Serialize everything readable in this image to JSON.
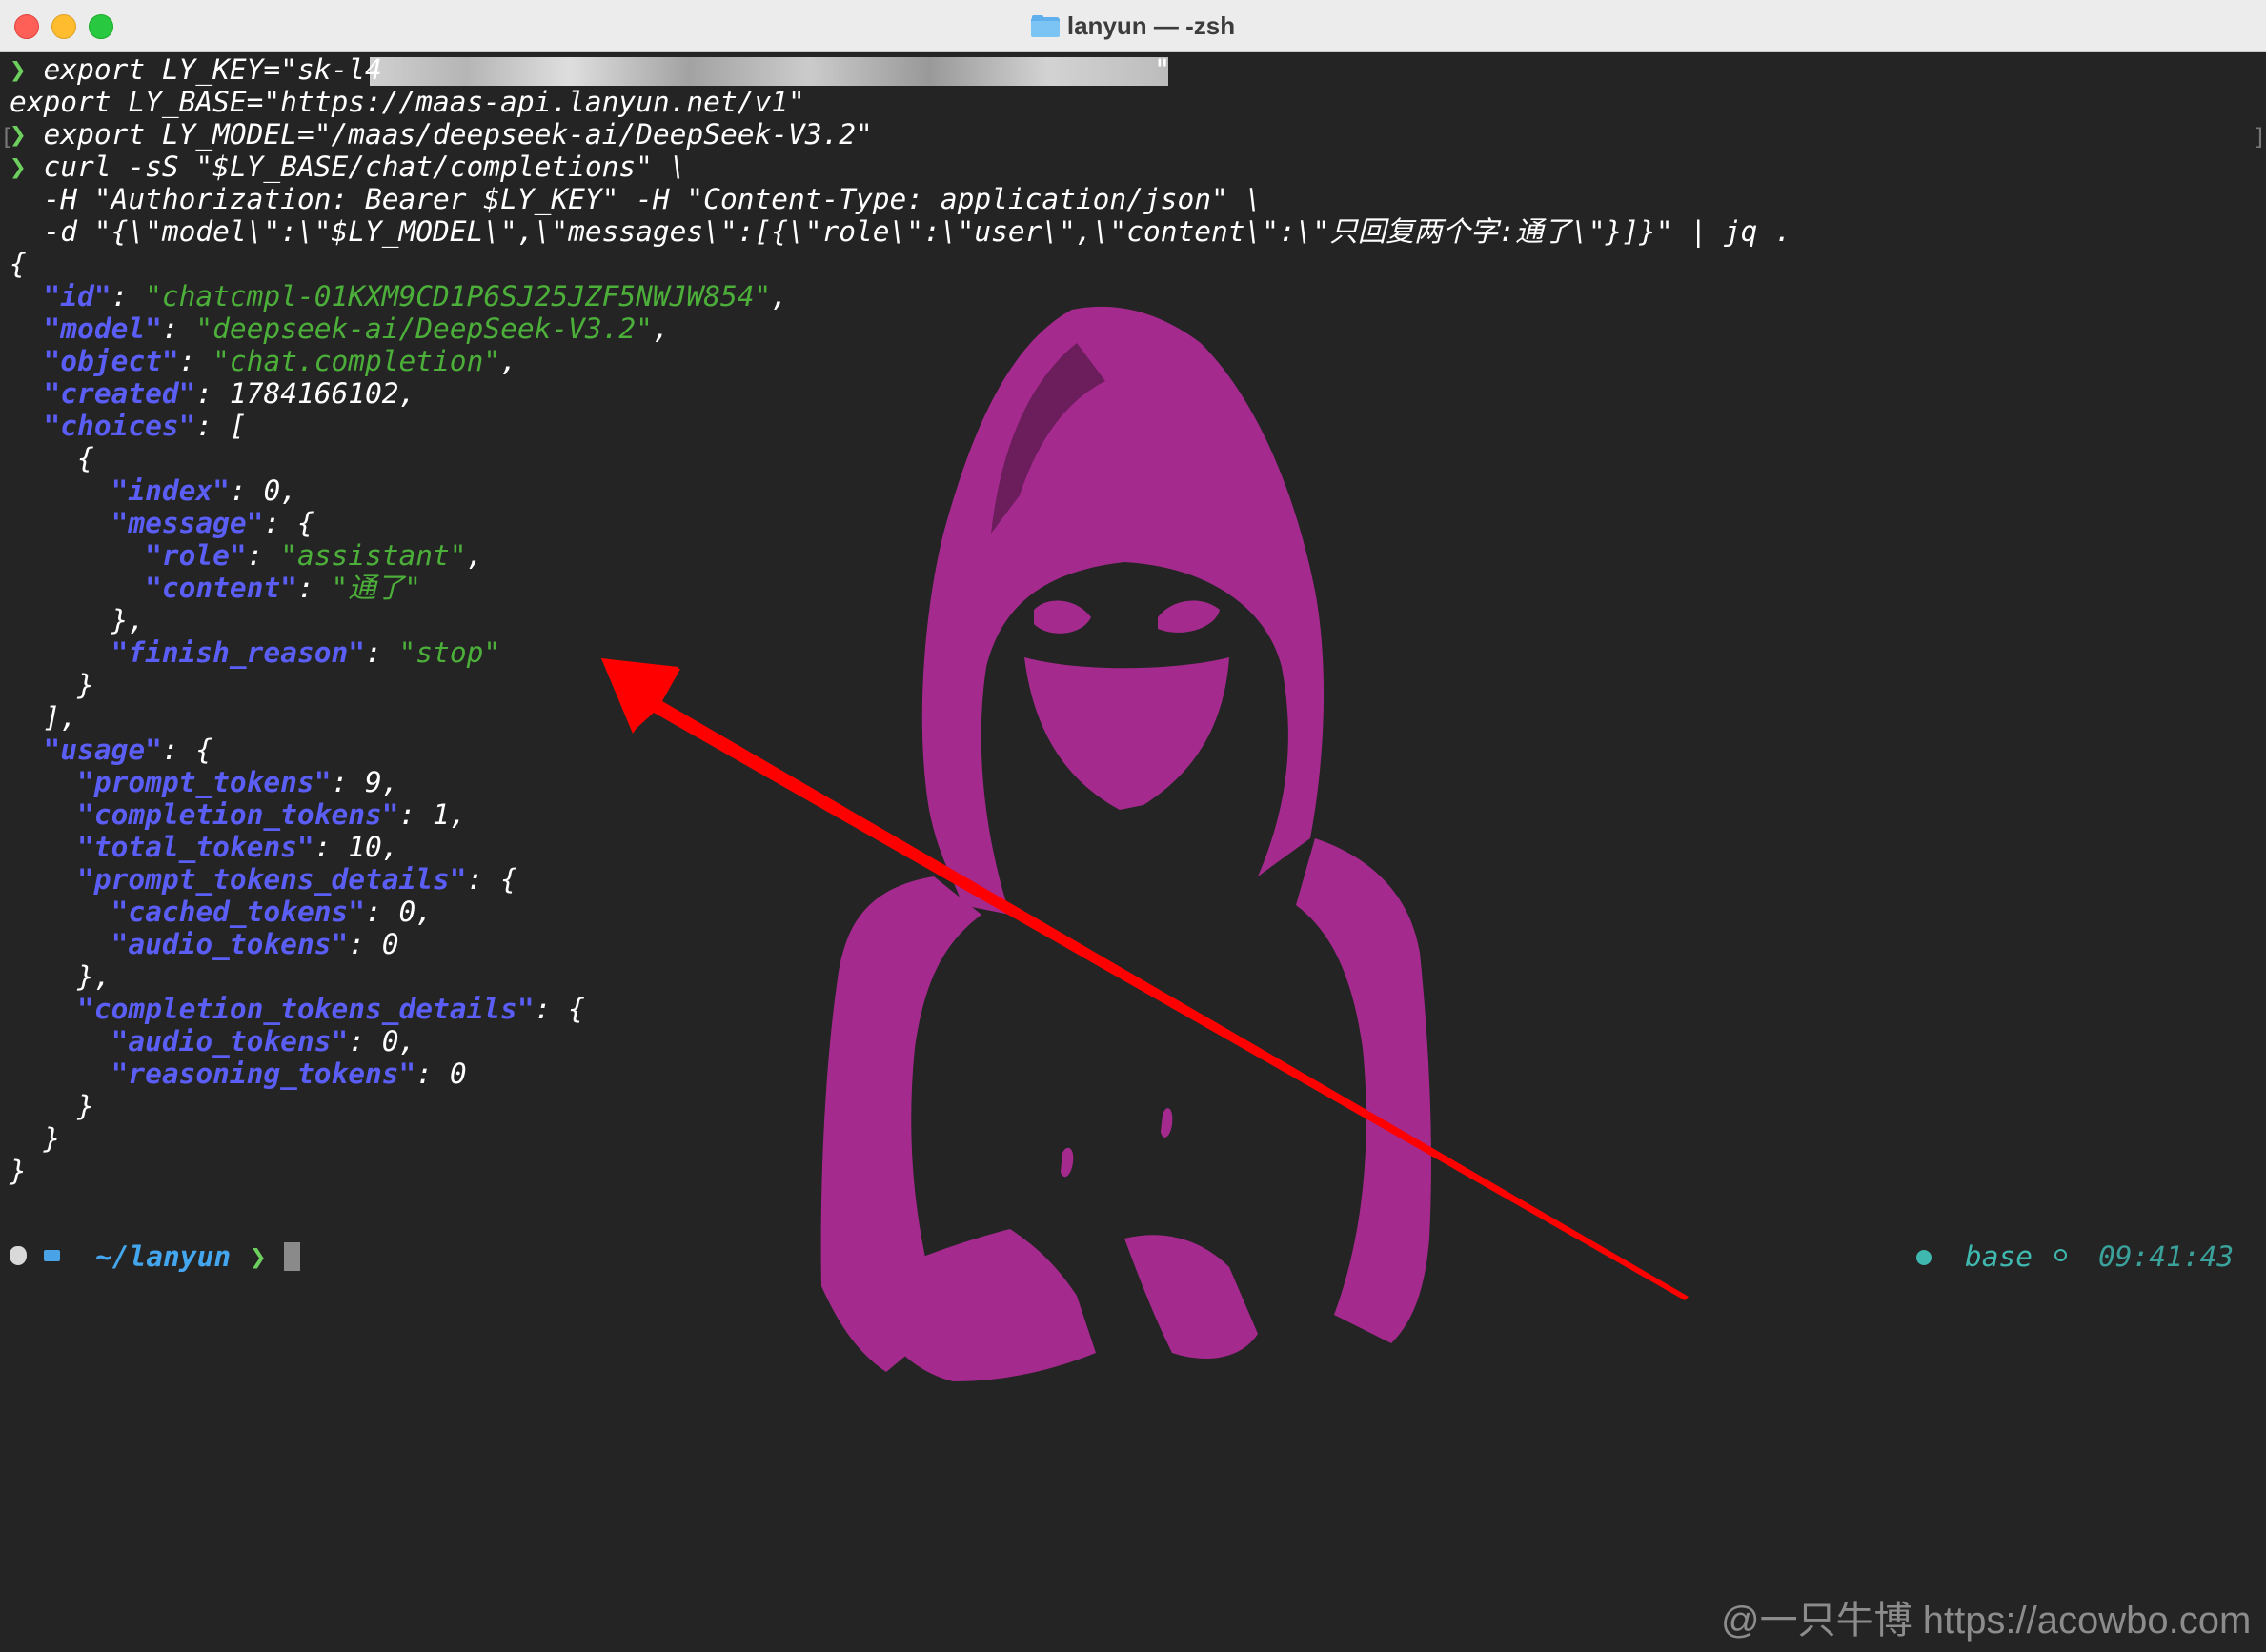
{
  "window": {
    "title": "lanyun — -zsh",
    "folder_icon": "folder-icon"
  },
  "terminal": {
    "prompt_symbol": "❯",
    "lines": {
      "l1": "export LY_KEY=\"sk-l4",
      "l1_tail": "\"",
      "l2": "export LY_BASE=\"https://maas-api.lanyun.net/v1\"",
      "l3": "export LY_MODEL=\"/maas/deepseek-ai/DeepSeek-V3.2\"",
      "l4": "curl -sS \"$LY_BASE/chat/completions\" \\",
      "l5": "  -H \"Authorization: Bearer $LY_KEY\" -H \"Content-Type: application/json\" \\",
      "l6": "  -d \"{\\\"model\\\":\\\"$LY_MODEL\\\",\\\"messages\\\":[{\\\"role\\\":\\\"user\\\",\\\"content\\\":\\\"只回复两个字:通了\\\"}]}\" | jq ."
    },
    "json": {
      "open": "{",
      "id_key": "\"id\"",
      "id_val": "\"chatcmpl-01KXM9CD1P6SJ25JZF5NWJW854\"",
      "model_key": "\"model\"",
      "model_val": "\"deepseek-ai/DeepSeek-V3.2\"",
      "object_key": "\"object\"",
      "object_val": "\"chat.completion\"",
      "created_key": "\"created\"",
      "created_val": "1784166102",
      "choices_key": "\"choices\"",
      "index_key": "\"index\"",
      "index_val": "0",
      "message_key": "\"message\"",
      "role_key": "\"role\"",
      "role_val": "\"assistant\"",
      "content_key": "\"content\"",
      "content_val": "\"通了\"",
      "finish_key": "\"finish_reason\"",
      "finish_val": "\"stop\"",
      "usage_key": "\"usage\"",
      "prompt_tokens_key": "\"prompt_tokens\"",
      "prompt_tokens_val": "9",
      "completion_tokens_key": "\"completion_tokens\"",
      "completion_tokens_val": "1",
      "total_tokens_key": "\"total_tokens\"",
      "total_tokens_val": "10",
      "ptd_key": "\"prompt_tokens_details\"",
      "cached_key": "\"cached_tokens\"",
      "cached_val": "0",
      "audio_key": "\"audio_tokens\"",
      "audio_val": "0",
      "ctd_key": "\"completion_tokens_details\"",
      "audio2_key": "\"audio_tokens\"",
      "audio2_val": "0",
      "reasoning_key": "\"reasoning_tokens\"",
      "reasoning_val": "0"
    },
    "prompt": {
      "path": "~/lanyun",
      "chevron": "❯",
      "env": "base",
      "time": "09:41:43"
    }
  },
  "watermark": "@一只牛博 https://acowbo.com",
  "colors": {
    "background": "#242424",
    "json_key": "#5a5ef5",
    "json_string": "#4caf3a",
    "prompt_green": "#6dd05e",
    "path_blue": "#44a6ef",
    "env_teal": "#3fb8af",
    "arrow_red": "#ff0000",
    "figure_magenta": "#a52a8e"
  }
}
